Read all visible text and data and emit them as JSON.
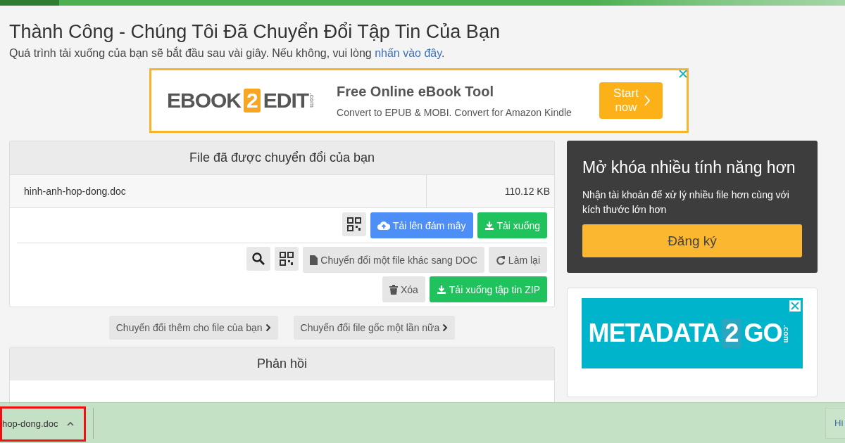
{
  "page": {
    "title": "Thành Công - Chúng Tôi Đã Chuyển Đổi Tập Tin Của Bạn",
    "subtitle": "Quá trình tải xuống của bạn sẽ bắt đầu sau vài giây. Nếu không, vui lòng ",
    "subtitle_link": "nhấn vào đây",
    "subtitle_end": "."
  },
  "top_ad": {
    "logo": [
      "EBOOK",
      "2",
      "EDIT",
      ".com"
    ],
    "headline": "Free Online eBook Tool",
    "text": "Convert to EPUB & MOBI. Convert for Amazon Kindle",
    "button": "Start now"
  },
  "files_panel": {
    "heading": "File đã được chuyển đổi của bạn",
    "file": {
      "name": "hinh-anh-hop-dong.doc",
      "size": "110.12 KB"
    },
    "action_rows": [
      [
        {
          "kind": "qr"
        },
        {
          "kind": "upload",
          "label": "Tải lên đám mây"
        },
        {
          "kind": "download",
          "label": "Tải xuống"
        }
      ],
      [
        {
          "kind": "search"
        },
        {
          "kind": "qr"
        },
        {
          "kind": "convert",
          "label": "Chuyển đổi một file khác sang DOC"
        },
        {
          "kind": "redo",
          "label": "Làm lại"
        }
      ],
      [
        {
          "kind": "delete",
          "label": "Xóa"
        },
        {
          "kind": "download",
          "label": "Tải xuống tập tin ZIP"
        }
      ]
    ]
  },
  "more_buttons": [
    {
      "label": "Chuyển đổi thêm cho file của bạn"
    },
    {
      "label": "Chuyển đổi file gốc một lần nữa"
    }
  ],
  "feedback": {
    "heading": "Phản hồi"
  },
  "promo": {
    "title": "Mở khóa nhiều tính năng hơn",
    "text": "Nhận tài khoản để xử lý nhiều file hơn cùng với kích thước lớn hơn",
    "button": "Đăng ký"
  },
  "side_ad": {
    "logo": [
      "METADATA",
      "2",
      "GO",
      ".com"
    ]
  },
  "download_bar": {
    "item": "hop-dong.doc",
    "right_button": "Hi"
  }
}
